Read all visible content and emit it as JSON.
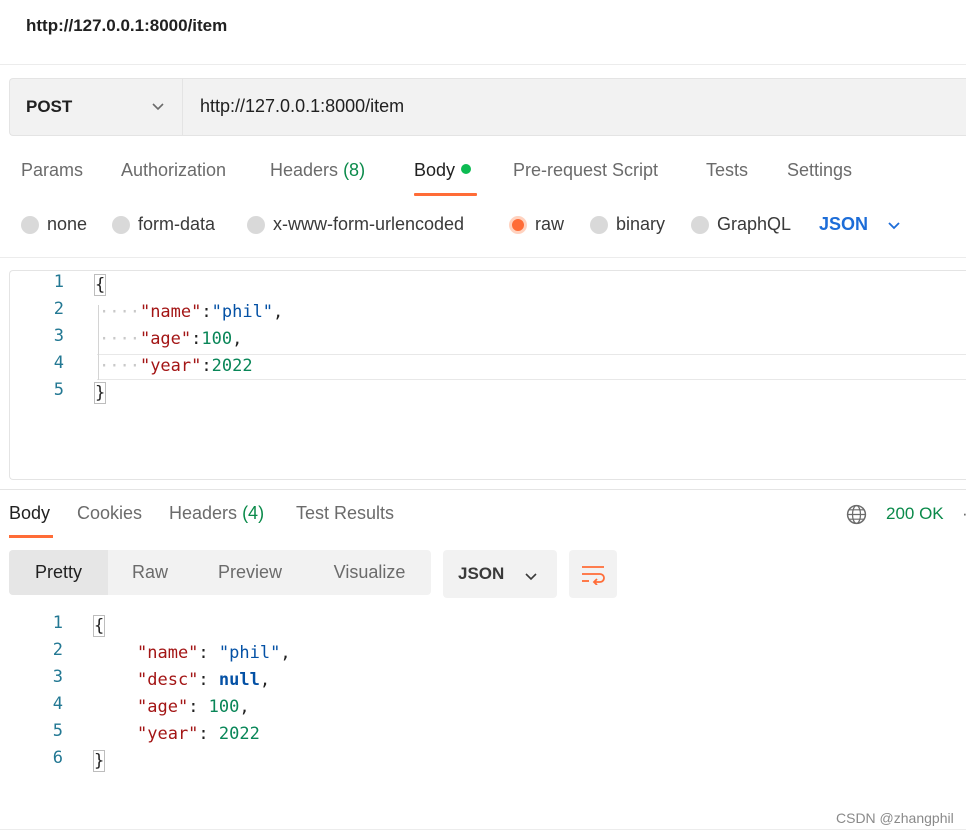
{
  "request": {
    "title": "http://127.0.0.1:8000/item",
    "method": "POST",
    "url": "http://127.0.0.1:8000/item",
    "tabs": {
      "params": "Params",
      "authorization": "Authorization",
      "headers": "Headers",
      "headers_count": "(8)",
      "body": "Body",
      "prerequest": "Pre-request Script",
      "tests": "Tests",
      "settings": "Settings"
    },
    "body_types": {
      "none": "none",
      "form_data": "form-data",
      "urlencoded": "x-www-form-urlencoded",
      "raw": "raw",
      "binary": "binary",
      "graphql": "GraphQL"
    },
    "selected_body_type": "raw",
    "raw_format": "JSON",
    "body_lines": {
      "n1": "1",
      "n2": "2",
      "n3": "3",
      "n4": "4",
      "n5": "5",
      "open": "{",
      "close": "}",
      "k1": "\"name\"",
      "v1": "\"phil\"",
      "k2": "\"age\"",
      "v2": "100",
      "k3": "\"year\"",
      "v3": "2022"
    }
  },
  "response": {
    "tabs": {
      "body": "Body",
      "cookies": "Cookies",
      "headers": "Headers",
      "headers_count": "(4)",
      "test_results": "Test Results"
    },
    "status": "200 OK",
    "view_modes": {
      "pretty": "Pretty",
      "raw": "Raw",
      "preview": "Preview",
      "visualize": "Visualize"
    },
    "format": "JSON",
    "body_lines": {
      "n1": "1",
      "n2": "2",
      "n3": "3",
      "n4": "4",
      "n5": "5",
      "n6": "6",
      "open": "{",
      "close": "}",
      "k1": "\"name\"",
      "v1": "\"phil\"",
      "k2": "\"desc\"",
      "v2": "null",
      "k3": "\"age\"",
      "v3": "100",
      "k4": "\"year\"",
      "v4": "2022"
    }
  },
  "watermark": "CSDN @zhangphil",
  "colors": {
    "accent": "#ff6c37",
    "success": "#0a8a4a",
    "link": "#1d6dd8",
    "json_key": "#a31515",
    "json_string": "#0451a5",
    "json_number": "#098658"
  }
}
